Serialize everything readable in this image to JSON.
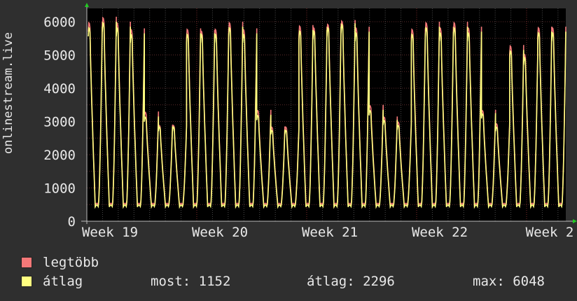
{
  "chart_data": {
    "type": "line",
    "ylabel": "onlinestream.live",
    "ylim": [
      0,
      6400
    ],
    "yticks": [
      0,
      1000,
      2000,
      3000,
      4000,
      5000,
      6000
    ],
    "xticks": [
      "Week 19",
      "Week 20",
      "Week 21",
      "Week 22",
      "Week 2"
    ],
    "grid": true,
    "background": "#000000",
    "series": [
      {
        "name": "legtöbb",
        "color": "#f47878",
        "daily_peaks": [
          6000,
          6150,
          6000,
          5800,
          3300,
          2900,
          2900,
          5800,
          5750,
          5800,
          6000,
          5800,
          3350,
          2850,
          2850,
          5900,
          5850,
          5950,
          6050,
          5850,
          3500,
          3150,
          3000,
          5800,
          6000,
          5850,
          6000,
          5850,
          3350,
          2950,
          5300,
          5050,
          5850,
          5850
        ]
      },
      {
        "name": "átlag",
        "color": "#ffff80",
        "daily_peaks": [
          5850,
          6000,
          5850,
          5650,
          3150,
          2850,
          2850,
          5650,
          5650,
          5650,
          5850,
          5650,
          3200,
          2750,
          2750,
          5750,
          5750,
          5850,
          5950,
          5700,
          3350,
          3050,
          2900,
          5650,
          5850,
          5700,
          5850,
          5700,
          3250,
          2850,
          5150,
          4950,
          5700,
          5700
        ]
      }
    ],
    "stats": {
      "most_label": "most:",
      "most_value": "1152",
      "atlag_label": "átlag:",
      "atlag_value": "2296",
      "max_label": "max:",
      "max_value": "6048"
    }
  },
  "legend": [
    {
      "label": "legtöbb",
      "color": "#f47878"
    },
    {
      "label": "átlag",
      "color": "#ffff80"
    }
  ]
}
